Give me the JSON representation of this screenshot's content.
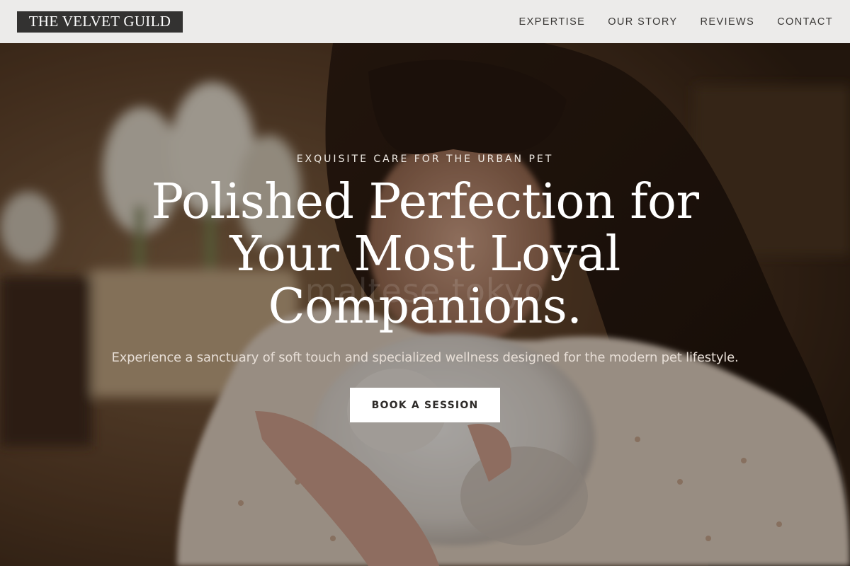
{
  "header": {
    "logo": "THE VELVET GUILD",
    "nav": [
      {
        "label": "EXPERTISE"
      },
      {
        "label": "OUR STORY"
      },
      {
        "label": "REVIEWS"
      },
      {
        "label": "CONTACT"
      }
    ]
  },
  "hero": {
    "eyebrow": "EXQUISITE CARE FOR THE URBAN PET",
    "headline": "Polished Perfection for Your Most Loyal Companions.",
    "subtext": "Experience a sanctuary of soft touch and specialized wellness designed for the modern pet lifestyle.",
    "cta_label": "BOOK A SESSION",
    "watermark": "maltese tokyo"
  },
  "colors": {
    "header_bg": "#ecebea",
    "logo_bg": "#333231",
    "cta_bg": "#ffffff",
    "cta_text": "#2e2b29"
  }
}
